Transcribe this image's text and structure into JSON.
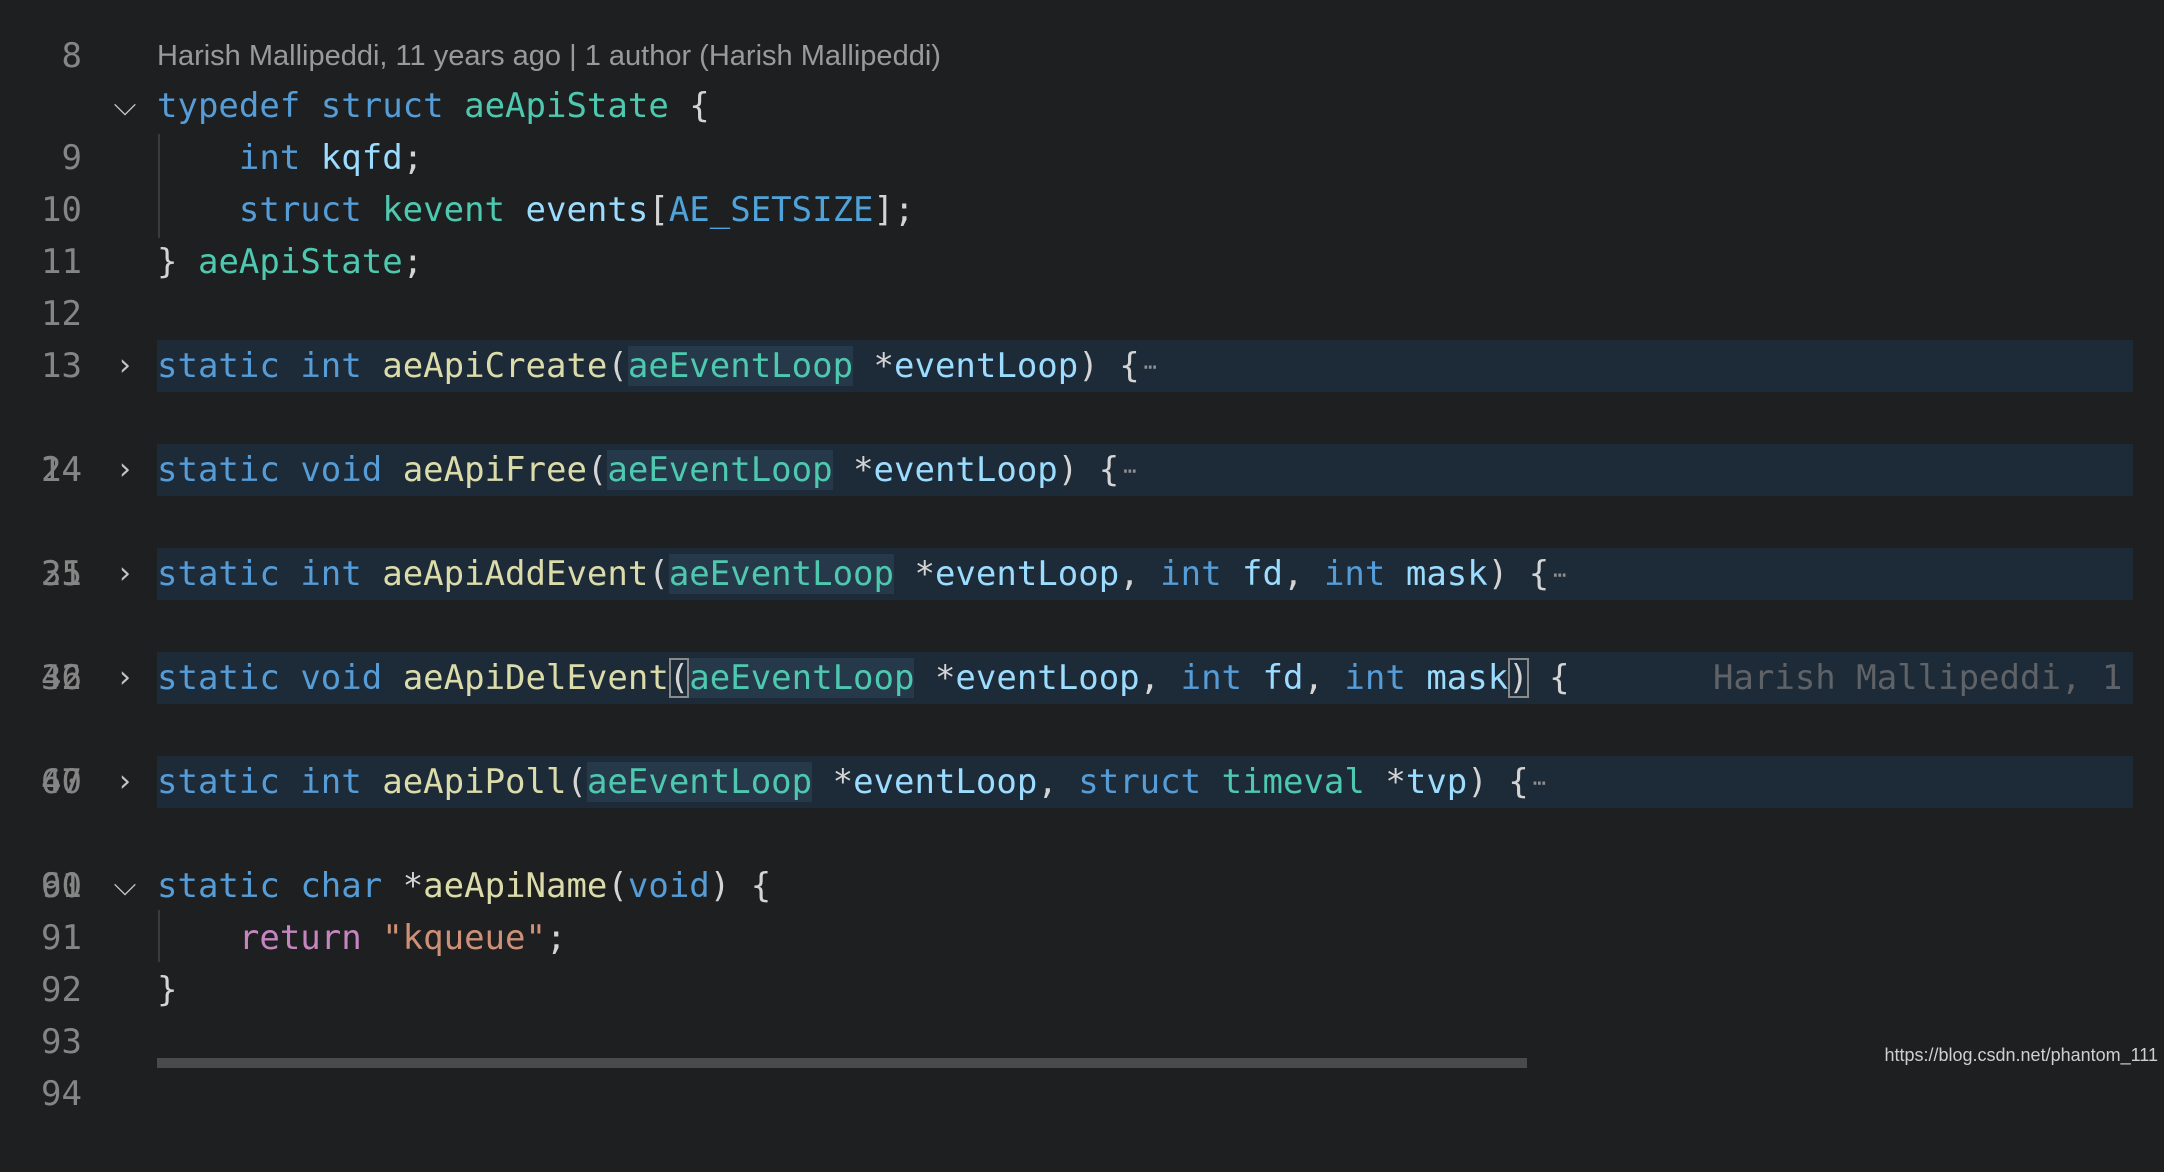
{
  "editor": {
    "top_line_number": "8",
    "blame_header": "Harish Mallipeddi, 11 years ago | 1 author (Harish Mallipeddi)",
    "inline_blame": "Harish Mallipeddi, 1",
    "lines": [
      {
        "n": "9",
        "fold": "expanded"
      },
      {
        "n": "10"
      },
      {
        "n": "11"
      },
      {
        "n": "12"
      },
      {
        "n": "13"
      },
      {
        "n": "14",
        "fold": "collapsed"
      },
      {
        "n": "24"
      },
      {
        "n": "25",
        "fold": "collapsed"
      },
      {
        "n": "31"
      },
      {
        "n": "32",
        "fold": "collapsed"
      },
      {
        "n": "46"
      },
      {
        "n": "47",
        "fold": "collapsed"
      },
      {
        "n": "60"
      },
      {
        "n": "61",
        "fold": "collapsed"
      },
      {
        "n": "90"
      },
      {
        "n": "91",
        "fold": "expanded"
      },
      {
        "n": "92"
      },
      {
        "n": "93"
      },
      {
        "n": "94"
      }
    ],
    "tokens": {
      "typedef": "typedef",
      "struct": "struct",
      "aeApiState": "aeApiState",
      "int": "int",
      "kqfd": "kqfd",
      "kevent": "kevent",
      "events": "events",
      "AE_SETSIZE": "AE_SETSIZE",
      "static": "static",
      "void": "void",
      "char": "char",
      "aeEventLoop": "aeEventLoop",
      "eventLoop": "eventLoop",
      "fd": "fd",
      "mask": "mask",
      "tvp": "tvp",
      "timeval": "timeval",
      "aeApiCreate": "aeApiCreate",
      "aeApiFree": "aeApiFree",
      "aeApiAddEvent": "aeApiAddEvent",
      "aeApiDelEvent": "aeApiDelEvent",
      "aeApiPoll": "aeApiPoll",
      "aeApiName": "aeApiName",
      "return": "return",
      "kqueue_str": "\"kqueue\""
    },
    "fold_icons": {
      "expanded": "chevron-down-icon",
      "collapsed": "chevron-right-icon"
    },
    "ellipsis": "⋯"
  },
  "watermark": "https://blog.csdn.net/phantom_111",
  "colors": {
    "background": "#1e1f20",
    "keyword": "#569cd6",
    "type": "#4ec9b0",
    "function": "#dcdcaa",
    "variable": "#9cdcfe",
    "string": "#ce9178",
    "control": "#c586c0",
    "folded_line_bg": "#1d2a38",
    "highlight": "#26394a"
  }
}
